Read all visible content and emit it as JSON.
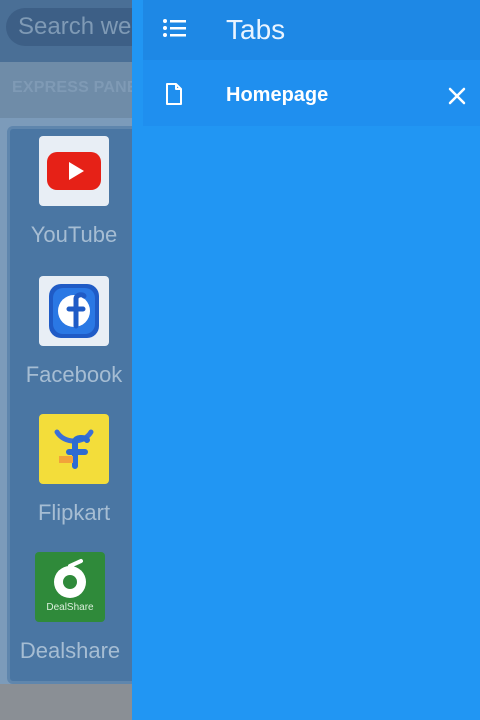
{
  "background": {
    "search_placeholder": "Search web",
    "express_panel_label": "EXPRESS PANEL",
    "tiles": [
      {
        "label": "YouTube"
      },
      {
        "label": "Facebook"
      },
      {
        "label": "Flipkart"
      },
      {
        "label": "Dealshare",
        "logo_text": "DealShare"
      }
    ]
  },
  "drawer": {
    "title": "Tabs",
    "tabs": [
      {
        "label": "Homepage"
      }
    ]
  },
  "colors": {
    "drawer_blue": "#2196f3",
    "header_blue": "#1e88e5",
    "youtube_red": "#e62117",
    "facebook_blue": "#1f5bc6",
    "flipkart_yellow": "#f3dd3a",
    "dealshare_green": "#2f8a3a"
  },
  "icons": {
    "menu": "list-icon",
    "tab": "document-icon",
    "close": "close-icon"
  }
}
